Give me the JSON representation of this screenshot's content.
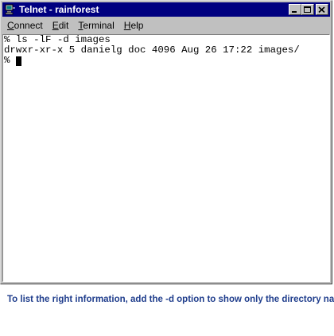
{
  "window": {
    "title": "Telnet - rainforest"
  },
  "menu": {
    "items": [
      {
        "underline": "C",
        "rest": "onnect"
      },
      {
        "underline": "E",
        "rest": "dit"
      },
      {
        "underline": "T",
        "rest": "erminal"
      },
      {
        "underline": "H",
        "rest": "elp"
      }
    ]
  },
  "terminal": {
    "lines": [
      "% ls -lF -d images",
      "drwxr-xr-x 5 danielg doc 4096 Aug 26 17:22 images/",
      "% "
    ]
  },
  "caption": "To list the right information, add the -d option to show only the directory name.",
  "colors": {
    "titlebar": "#000080",
    "caption": "#1f3d8c",
    "window_bg": "#c0c0c0"
  },
  "icons": {
    "app": "telnet-computer-icon",
    "minimize": "minimize-icon",
    "maximize": "maximize-icon",
    "close": "close-icon"
  }
}
